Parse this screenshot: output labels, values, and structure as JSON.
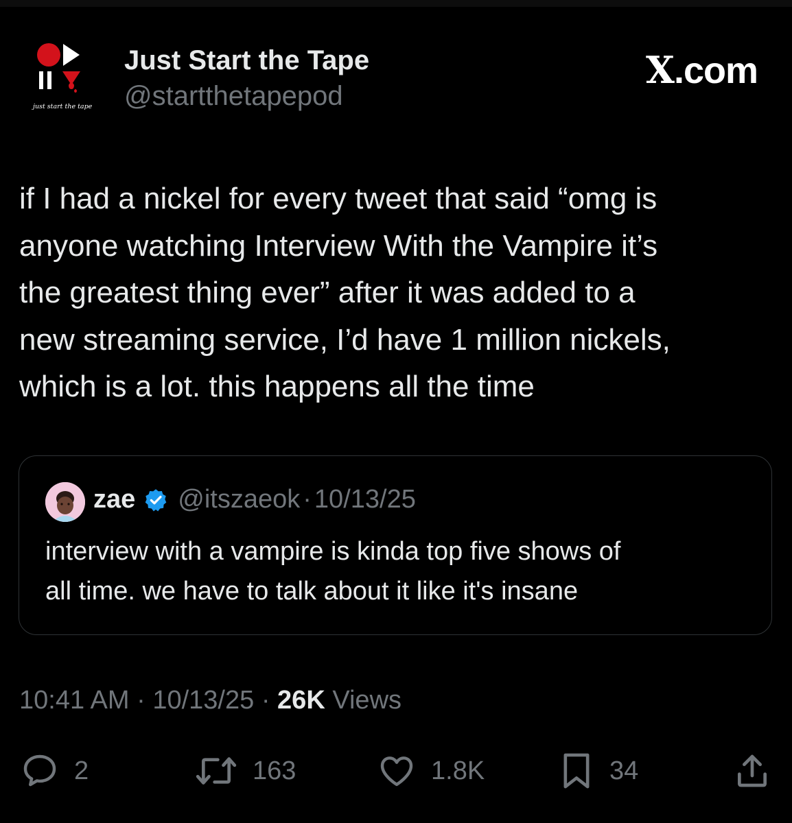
{
  "header": {
    "logo_caption": "just start the tape",
    "account_name": "Just Start the Tape",
    "account_handle": "@startthetapepod",
    "site_label_x": "X",
    "site_label_suffix": ".com"
  },
  "tweet": {
    "text_lines": [
      "if I had a nickel for every tweet that said “omg is",
      "anyone watching Interview With the Vampire it’s",
      "the greatest thing ever” after it was added to a",
      "new streaming service, I’d have 1 million nickels,",
      "which is a lot. this happens all the time"
    ]
  },
  "quoted_tweet": {
    "name": "zae",
    "handle": "@itszaeok",
    "separator": "·",
    "date": "10/13/25",
    "text_lines": [
      "interview with a vampire is kinda top five shows of",
      "all time. we have to talk about it like it's insane"
    ]
  },
  "meta": {
    "time": "10:41 AM",
    "separator": "·",
    "date": "10/13/25",
    "views_count": "26K",
    "views_label": "Views"
  },
  "actions": {
    "replies": "2",
    "reposts": "163",
    "likes": "1.8K",
    "bookmarks": "34"
  },
  "colors": {
    "background": "#000000",
    "primary_text": "#e7e9ea",
    "secondary_text": "#71767b",
    "border": "#2f3336",
    "verified_blue": "#1d9bf0",
    "logo_red": "#d3121b"
  },
  "icons": [
    "play-logo-icon",
    "verified-badge-icon",
    "reply-icon",
    "repost-icon",
    "like-icon",
    "bookmark-icon",
    "share-icon"
  ]
}
